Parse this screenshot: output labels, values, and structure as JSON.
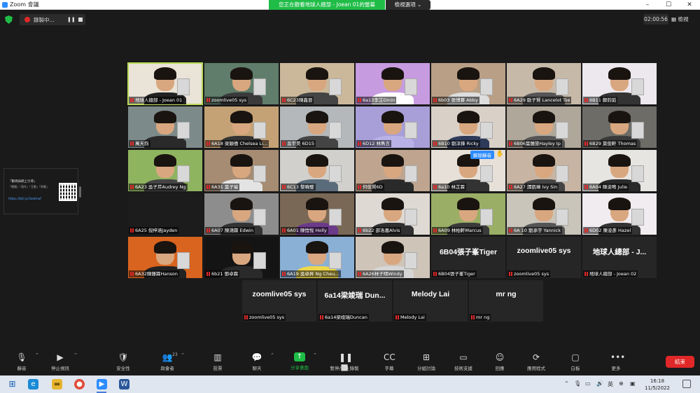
{
  "window": {
    "title": "Zoom 會議",
    "share_banner": "您正在觀看地球人總部 - Joean 01的螢幕",
    "view_options": "檢視選項 ⌄",
    "min": "–",
    "max": "☐",
    "close": "✕"
  },
  "recording": {
    "label": "錄製中...",
    "pause": "❚❚"
  },
  "timer": "02:00:56",
  "gallery_view": "檢視",
  "share_thumb": {
    "line1": "「數碼與網上引導」",
    "line2": "「閱讀」「寫作」「互動」「聆聽」",
    "link": "https://bit.ly/3xe6rwf"
  },
  "tiles": [
    {
      "name": "地球人總部 - Joean 01",
      "bg": "#e9e3d8",
      "shirt": "#222",
      "active": true
    },
    {
      "name": "zoomlive05 sys",
      "bg": "#5f7d6a",
      "shirt": "#3a3a3a"
    },
    {
      "name": "6C23陳鑫晉",
      "bg": "#cbb89a",
      "shirt": "#444"
    },
    {
      "name": "6a13李芷Dinin",
      "bg": "#c79be0",
      "shirt": "#fff"
    },
    {
      "name": "6b03 張博賽 Abby",
      "bg": "#b89f86",
      "shirt": "#ddd"
    },
    {
      "name": "6A29 歐子賢 Lancelot Tse",
      "bg": "#c7b9a8",
      "shirt": "#555"
    },
    {
      "name": "6B11 鄭鈞茹",
      "bg": "#ece8ee",
      "shirt": "#333"
    },
    {
      "name": "萬天鈞",
      "bg": "#7d8a8a",
      "shirt": "#2a2a2a"
    },
    {
      "name": "6A18 梁穎僖 Chelsea Li...",
      "bg": "#c4a276",
      "shirt": "#333"
    },
    {
      "name": "吳宇昊 6D15",
      "bg": "#b4b8ba",
      "shirt": "#444"
    },
    {
      "name": "6D12 林雋言",
      "bg": "#a89ed8",
      "shirt": "#b9b2e6"
    },
    {
      "name": "6B10 劉淳鋒 Ricky",
      "bg": "#d9d0c8",
      "shirt": "#2e3a5a"
    },
    {
      "name": "6B06葉鍾旅Hayley Ip",
      "bg": "#afa79a",
      "shirt": "#555"
    },
    {
      "name": "6B29 莫俊軒 Thomas",
      "bg": "#6d6c66",
      "shirt": "#3a3a3a"
    },
    {
      "name": "6A23 吳子芹Audrey Ng",
      "bg": "#8fb460",
      "shirt": "#444"
    },
    {
      "name": "6A31 葉子瑜",
      "bg": "#a68c73",
      "shirt": "#e3e3e3"
    },
    {
      "name": "6C13 黎曉璧",
      "bg": "#d2d0cc",
      "shirt": "#5a6b7a"
    },
    {
      "name": "何俊賢6D",
      "bg": "#bfa58f",
      "shirt": "#2a2a2a"
    },
    {
      "name": "6a10 林芷霖",
      "bg": "#e6e0d8",
      "shirt": "#333",
      "unmute_request": "解除靜音",
      "hand": true
    },
    {
      "name": "6A27 譚凱琳 Ivy Sin",
      "bg": "#c7b4a2",
      "shirt": "#444"
    },
    {
      "name": "6A04 陳浚鳴 Julie",
      "bg": "#e7e5e2",
      "shirt": "#2a2a2a"
    },
    {
      "name": "6A25 倪梓涵Jayden",
      "bg": "#1c1c1c",
      "shirt": "#1c1c1c",
      "no_face": true
    },
    {
      "name": "6A07 陳鴻霖 Edwin",
      "bg": "#8d8d8d",
      "shirt": "#333"
    },
    {
      "name": "6A01 陳愷悅 Holly",
      "bg": "#7a6856",
      "shirt": "#6c3a8a"
    },
    {
      "name": "6b22 邵洛嘉Alvis",
      "bg": "#ded9d2",
      "shirt": "#303030"
    },
    {
      "name": "6A09 林柏軒Marcus",
      "bg": "#9aae66",
      "shirt": "#3a3a3a"
    },
    {
      "name": "6A 10 劉承宇 Yannick",
      "bg": "#c9c5bb",
      "shirt": "#555"
    },
    {
      "name": "6D02 陳浚彥 Hazel",
      "bg": "#f1ecef",
      "shirt": "#333"
    },
    {
      "name": "6A32陳鍾霖Hanson",
      "bg": "#d9641f",
      "shirt": "#222"
    },
    {
      "name": "6b21 鄧卓霖",
      "bg": "#141414",
      "shirt": "#2a2a2a"
    },
    {
      "name": "6A19 吳卓昇 Ng Cheu...",
      "bg": "#8bb0d6",
      "shirt": "#efd74b"
    },
    {
      "name": "6A26林子晴Windy",
      "bg": "#cfc4b8",
      "shirt": "#d6d6d6"
    },
    {
      "name": "6B04張子峯Tiger",
      "big": "6B04張子峯Tiger",
      "blank": true
    },
    {
      "name": "zoomlive05 sys",
      "big": "zoomlive05 sys",
      "blank": true
    },
    {
      "name": "地球人總部 - Joean 02",
      "big": "地球人總部 - J...",
      "blank": true
    },
    {
      "name": "zoomlive05 sys",
      "big": "zoomlive05 sys",
      "blank": true
    },
    {
      "name": "6a14梁竣瑞Duncan",
      "big": "6a14梁竣瑞 Dun...",
      "blank": true
    },
    {
      "name": "Melody Lai",
      "big": "Melody Lai",
      "blank": true
    },
    {
      "name": "mr ng",
      "big": "mr ng",
      "blank": true
    }
  ],
  "toolbar": [
    {
      "label": "靜音",
      "icon": "🎙",
      "caret": true
    },
    {
      "label": "停止視訊",
      "icon": "▶",
      "caret": true
    },
    {
      "label": "安全性",
      "icon": "🛡"
    },
    {
      "label": "與會者",
      "icon": "👥",
      "caret": true,
      "count": "23"
    },
    {
      "label": "投票",
      "icon": "▥"
    },
    {
      "label": "聊天",
      "icon": "💬",
      "caret": true
    },
    {
      "label": "分享畫面",
      "icon": "↑",
      "caret": true,
      "share": true
    },
    {
      "label": "暫停/停止錄製",
      "icon": "❚❚ ■"
    },
    {
      "label": "字幕",
      "icon": "CC"
    },
    {
      "label": "分組討論",
      "icon": "⊞"
    },
    {
      "label": "技術支援",
      "icon": "▭"
    },
    {
      "label": "回應",
      "icon": "☺"
    },
    {
      "label": "應用程式",
      "icon": "⟳"
    },
    {
      "label": "白板",
      "icon": "▢"
    },
    {
      "label": "更多",
      "icon": "•••"
    }
  ],
  "end_button": "結束",
  "taskbar": {
    "time": "16:18",
    "date": "11/5/2022",
    "lang": "英",
    "tray_caret": "⌃"
  },
  "colors": {
    "accent": "#2d8cff",
    "green": "#1fbd47",
    "end": "#e02828",
    "active_outline": "#b9d957"
  }
}
